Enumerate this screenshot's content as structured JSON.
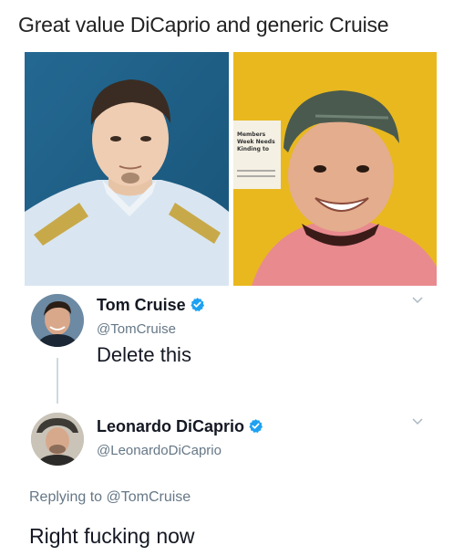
{
  "caption": "Great value DiCaprio and generic Cruise",
  "photos": {
    "sign_lines": [
      "Members",
      "Week Needs",
      "Kinding to"
    ]
  },
  "tweet1": {
    "name": "Tom Cruise",
    "handle": "@TomCruise",
    "text": "Delete this"
  },
  "tweet2": {
    "name": "Leonardo DiCaprio",
    "handle": "@LeonardoDiCaprio"
  },
  "reply": {
    "prefix": "Replying to ",
    "mention": "@TomCruise",
    "text": "Right fucking now"
  },
  "colors": {
    "verified": "#1da1f2",
    "handle_gray": "#657786",
    "left_bg": "#1f5f86",
    "right_bg": "#e9b81f"
  },
  "icons": [
    "verified-badge-icon",
    "chevron-down-icon"
  ]
}
